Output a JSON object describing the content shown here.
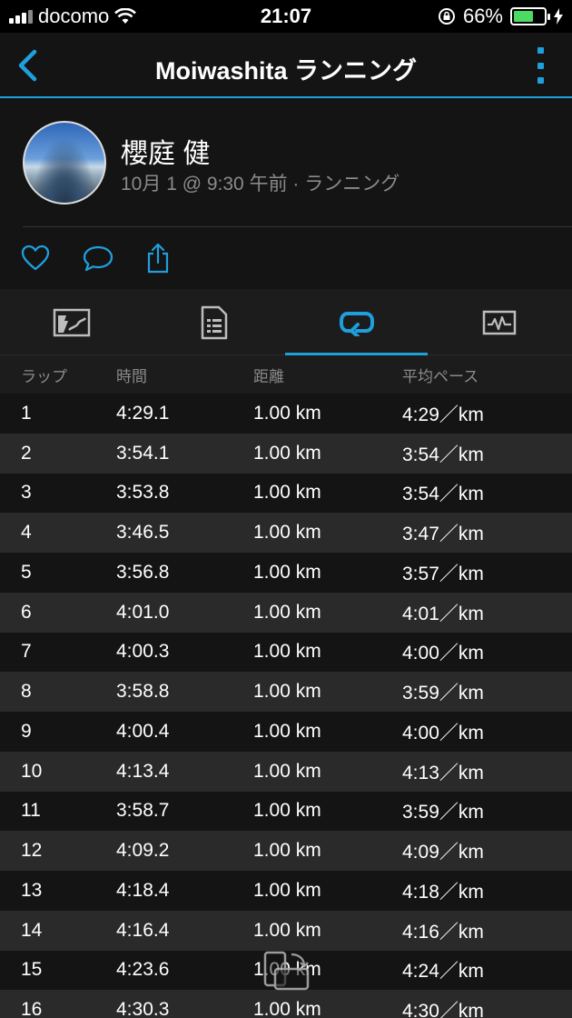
{
  "status_bar": {
    "carrier": "docomo",
    "time": "21:07",
    "battery_percent": "66%",
    "battery_level": 0.66,
    "battery_color": "#4cd964"
  },
  "header": {
    "title": "Moiwashita ランニング",
    "accent_color": "#1f9fdc"
  },
  "profile": {
    "name": "櫻庭 健",
    "meta": "10月 1 @ 9:30 午前 · ランニング"
  },
  "actions": [
    "heart-icon",
    "comment-icon",
    "share-icon"
  ],
  "tabs": [
    {
      "icon": "map-icon"
    },
    {
      "icon": "details-icon"
    },
    {
      "icon": "laps-icon",
      "active": true
    },
    {
      "icon": "chart-icon"
    }
  ],
  "table": {
    "columns": [
      "ラップ",
      "時間",
      "距離",
      "平均ペース"
    ],
    "rows": [
      {
        "lap": "1",
        "time": "4:29.1",
        "distance": "1.00 km",
        "pace": "4:29／km"
      },
      {
        "lap": "2",
        "time": "3:54.1",
        "distance": "1.00 km",
        "pace": "3:54／km"
      },
      {
        "lap": "3",
        "time": "3:53.8",
        "distance": "1.00 km",
        "pace": "3:54／km"
      },
      {
        "lap": "4",
        "time": "3:46.5",
        "distance": "1.00 km",
        "pace": "3:47／km"
      },
      {
        "lap": "5",
        "time": "3:56.8",
        "distance": "1.00 km",
        "pace": "3:57／km"
      },
      {
        "lap": "6",
        "time": "4:01.0",
        "distance": "1.00 km",
        "pace": "4:01／km"
      },
      {
        "lap": "7",
        "time": "4:00.3",
        "distance": "1.00 km",
        "pace": "4:00／km"
      },
      {
        "lap": "8",
        "time": "3:58.8",
        "distance": "1.00 km",
        "pace": "3:59／km"
      },
      {
        "lap": "9",
        "time": "4:00.4",
        "distance": "1.00 km",
        "pace": "4:00／km"
      },
      {
        "lap": "10",
        "time": "4:13.4",
        "distance": "1.00 km",
        "pace": "4:13／km"
      },
      {
        "lap": "11",
        "time": "3:58.7",
        "distance": "1.00 km",
        "pace": "3:59／km"
      },
      {
        "lap": "12",
        "time": "4:09.2",
        "distance": "1.00 km",
        "pace": "4:09／km"
      },
      {
        "lap": "13",
        "time": "4:18.4",
        "distance": "1.00 km",
        "pace": "4:18／km"
      },
      {
        "lap": "14",
        "time": "4:16.4",
        "distance": "1.00 km",
        "pace": "4:16／km"
      },
      {
        "lap": "15",
        "time": "4:23.6",
        "distance": "1.00 km",
        "pace": "4:24／km"
      },
      {
        "lap": "16",
        "time": "4:30.3",
        "distance": "1.00 km",
        "pace": "4:30／km"
      }
    ]
  }
}
